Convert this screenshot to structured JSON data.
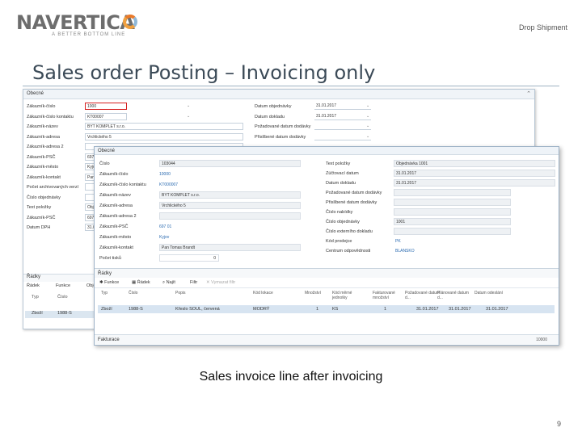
{
  "logo": {
    "wordmark": "NAVERTICA",
    "tagline": "A BETTER BOTTOM LINE"
  },
  "section_tag": "Drop Shipment",
  "title": "Sales order Posting – Invoicing only",
  "caption": "Sales invoice line after invoicing",
  "page_number": "9",
  "back_window": {
    "header": "Obecné",
    "left_fields": [
      {
        "label": "Zákazník-číslo",
        "value": "1000"
      },
      {
        "label": "Zákazník-číslo kontaktu",
        "value": "KT00007"
      },
      {
        "label": "Zákazník-název",
        "value": "BYT KOMPLET s.r.o."
      },
      {
        "label": "Zákazník-adresa",
        "value": "Vrchlického 5"
      },
      {
        "label": "Zákazník-adresa 2",
        "value": ""
      },
      {
        "label": "Zákazník-PSČ",
        "value": "697 01"
      },
      {
        "label": "Zákazník-město",
        "value": "Kyjov"
      },
      {
        "label": "Zákazník-kontakt",
        "value": "Pan"
      },
      {
        "label": "Počet archivovaných verzí",
        "value": ""
      },
      {
        "label": "Číslo objednávky",
        "value": ""
      },
      {
        "label": "Text položky",
        "value": "Objed"
      },
      {
        "label": "Zákazník-PSČ",
        "value": "697 01"
      },
      {
        "label": "Datum DPH",
        "value": "31.01."
      }
    ],
    "right_fields": [
      {
        "label": "Datum objednávky",
        "value": "31.01.2017"
      },
      {
        "label": "Datum dokladu",
        "value": "31.01.2017"
      },
      {
        "label": "Požadované datum dodávky",
        "value": ""
      },
      {
        "label": "Přislíbené datum dodávky",
        "value": ""
      }
    ],
    "lines_header": "Řádky",
    "toolbar": [
      "Řádek",
      "Funkce",
      "Objed"
    ],
    "table_headers": [
      "Typ",
      "Číslo"
    ],
    "table_row": [
      "Zboží",
      "1988-S"
    ]
  },
  "front_window": {
    "header": "Obecné",
    "left_fields": [
      {
        "label": "Číslo",
        "value": "103044",
        "style": "field"
      },
      {
        "label": "Zákazník-číslo",
        "value": "10000",
        "style": "link"
      },
      {
        "label": "Zákazník-číslo kontaktu",
        "value": "KT000007",
        "style": "link"
      },
      {
        "label": "Zákazník-název",
        "value": "BYT KOMPLET s.r.o.",
        "style": "field"
      },
      {
        "label": "Zákazník-adresa",
        "value": "Vrchlického 5",
        "style": "field"
      },
      {
        "label": "Zákazník-adresa 2",
        "value": "",
        "style": "field"
      },
      {
        "label": "Zákazník-PSČ",
        "value": "697 01",
        "style": "link"
      },
      {
        "label": "Zákazník-město",
        "value": "Kyjov",
        "style": "link"
      },
      {
        "label": "Zákazník-kontakt",
        "value": "Pan Tomas Brandt",
        "style": "field"
      },
      {
        "label": "Počet tisků",
        "value": "0",
        "style": "number"
      }
    ],
    "right_fields": [
      {
        "label": "Text položky",
        "value": "Objednávka 1001",
        "style": "field"
      },
      {
        "label": "Zúčtovací datum",
        "value": "31.01.2017",
        "style": "field"
      },
      {
        "label": "Datum dokladu",
        "value": "31.01.2017",
        "style": "field"
      },
      {
        "label": "Požadované datum dodávky",
        "value": "",
        "style": "field"
      },
      {
        "label": "Přislíbené datum dodávky",
        "value": "",
        "style": "field"
      },
      {
        "label": "Číslo nabídky",
        "value": "",
        "style": "field"
      },
      {
        "label": "Číslo objednávky",
        "value": "1001",
        "style": "field"
      },
      {
        "label": "Číslo externího dokladu",
        "value": "",
        "style": "field"
      },
      {
        "label": "Kód prodejce",
        "value": "PK",
        "style": "link"
      },
      {
        "label": "Centrum odpovědnosti",
        "value": "BLANSKO",
        "style": "link"
      }
    ],
    "lines_header": "Řádky",
    "toolbar": {
      "functions": "Funkce",
      "line": "Řádek",
      "find": "Najít",
      "filter": "Filtr",
      "clear_filter": "Vymazat filtr"
    },
    "table_headers": [
      "Typ",
      "Číslo",
      "Popis",
      "Kód lokace",
      "Množství",
      "Kód měrné jednotky",
      "Fakturované množství",
      "Požadované datum d...",
      "Plánované datum d...",
      "Datum odeslání"
    ],
    "table_row": [
      "Zboží",
      "1988-S",
      "Křeslo SOUL, červená",
      "MODRÝ",
      "1",
      "KS",
      "1",
      "31.01.2017",
      "31.01.2017",
      "31.01.2017"
    ],
    "footer_label": "Fakturace",
    "footer_value": "10000"
  },
  "colors": {
    "title": "#3b4a57",
    "highlight_border": "#d62020",
    "link": "#2a6ab0",
    "row_selected": "#d7e4f1"
  }
}
